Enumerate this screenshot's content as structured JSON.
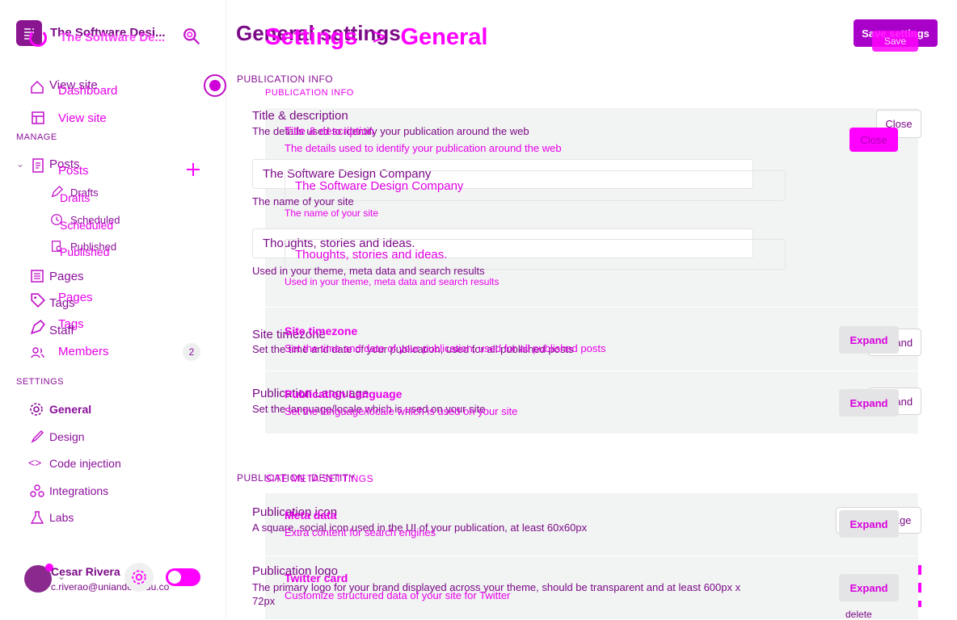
{
  "app": {
    "site_name": "The Software Desi...",
    "site_name_ghost": "The Software De..."
  },
  "sidebar": {
    "view_site": "View site",
    "dashboard": "Dashboard",
    "view_site_ghost": "View site",
    "manage_heading": "MANAGE",
    "posts": "Posts",
    "posts_ghost": "Posts",
    "drafts": "Drafts",
    "drafts_ghost": "Drafts",
    "scheduled": "Scheduled",
    "scheduled_ghost": "Scheduled",
    "published": "Published",
    "published_ghost": "Published",
    "pages": "Pages",
    "pages_ghost": "Pages",
    "tags": "Tags",
    "tags_ghost": "Tags",
    "staff": "Staff",
    "members": "Members",
    "members_count": "2",
    "settings_heading": "SETTINGS",
    "general": "General",
    "design": "Design",
    "code_injection": "Code injection",
    "integrations": "Integrations",
    "labs": "Labs"
  },
  "user": {
    "name": "Cesar Rivera",
    "email": "c.riverao@uniandes.edu.co"
  },
  "header": {
    "title": "General settings",
    "title_ghost_parent": "Settings",
    "title_ghost_sep": ">",
    "title_ghost_child": "General",
    "save_label": "Save settings",
    "save_ghost": "Save"
  },
  "publication_info": {
    "heading": "PUBLICATION INFO",
    "heading_ghost": "PUBLICATION INFO",
    "title_desc": {
      "title": "Title & description",
      "subtitle": "The details used to identify your publication around the web",
      "title_ghost": "Title & description",
      "subtitle_ghost": "The details used to identify your publication around the web",
      "close_label": "Close",
      "close_ghost": "Close",
      "site_title_value": "The Software Design Company",
      "site_title_ghost": "The Software Design Company",
      "site_title_hint": "The name of your site",
      "site_title_hint_ghost": "The name of your site",
      "description_value": "Thoughts, stories and ideas.",
      "description_ghost": "Thoughts, stories and ideas.",
      "description_hint": "Used in your theme, meta data and search results",
      "description_hint_ghost": "Used in your theme, meta data and search results"
    },
    "timezone": {
      "title": "Site timezone",
      "title_ghost": "Site timezone",
      "subtitle": "Set the time and date of your publication, used for all published posts",
      "subtitle_ghost": "Set the time and date of your publication, used for all published posts",
      "expand_label": "Expand",
      "expand_ghost": "Expand"
    },
    "language": {
      "title": "Publication Language",
      "title_ghost": "Publication Language",
      "subtitle": "Set the language/locale which is used on your site",
      "subtitle_ghost": "Set the language/locale which is used on your site",
      "expand_label": "Expand",
      "expand_ghost": "Expand"
    }
  },
  "publication_identity": {
    "heading": "PUBLICATION IDENTITY",
    "heading_ghost": "SITE META SETTINGS",
    "icon": {
      "title": "Publication icon",
      "subtitle": "A square, social icon used in the UI of your publication, at least 60x60px",
      "upload_label": "Upload Image"
    },
    "meta_data": {
      "title": "Meta data",
      "subtitle": "Extra content for search engines",
      "expand_label": "Expand"
    },
    "logo": {
      "title": "Publication logo",
      "subtitle": "The primary logo for your brand displayed across your theme, should be transparent and at least 600px x 72px",
      "delete_label": "delete"
    },
    "twitter": {
      "title": "Twitter card",
      "subtitle": "Customize structured data of your site for Twitter",
      "expand_label": "Expand"
    }
  },
  "colors": {
    "accent": "#ff00ff",
    "primary_text": "#7a0a86",
    "button_purple": "#a800c8",
    "card_bg": "#f2f3f3"
  },
  "icons": {
    "menu": "menu-icon",
    "search": "search-icon",
    "home": "home-icon",
    "posts": "posts-icon",
    "plus": "plus-icon",
    "gear": "gear-icon"
  }
}
